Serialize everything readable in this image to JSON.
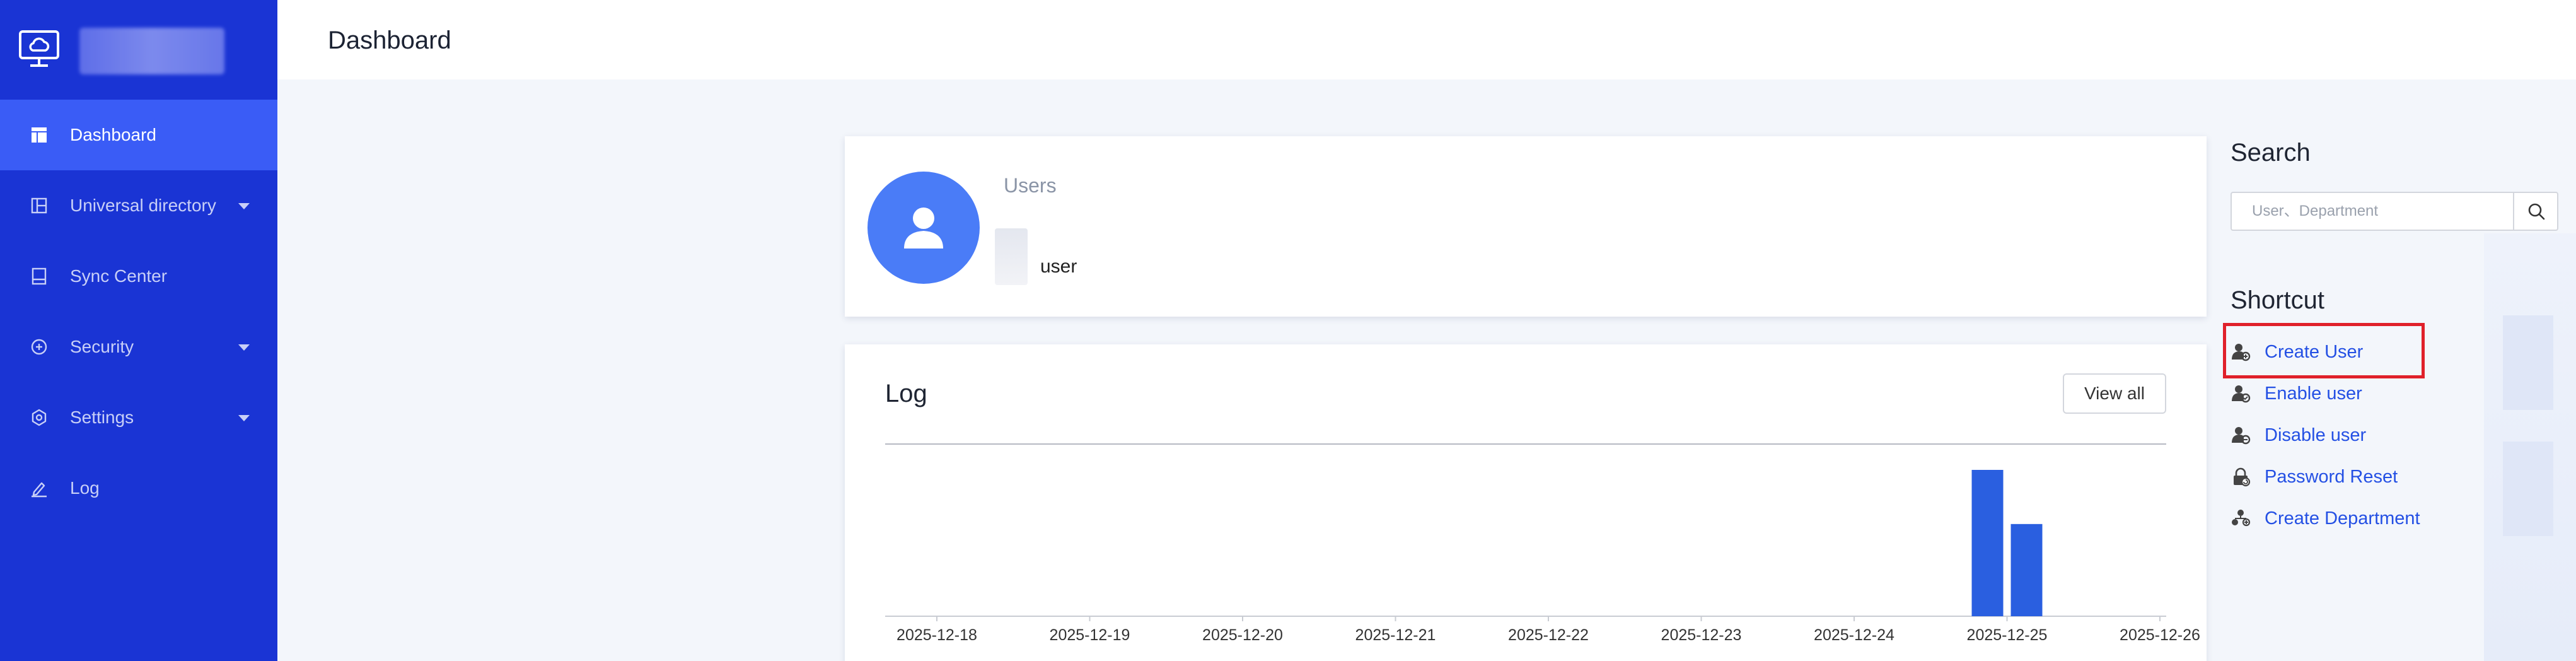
{
  "sidebar": {
    "items": [
      {
        "label": "Dashboard",
        "icon": "dashboard-icon",
        "active": true,
        "expandable": false
      },
      {
        "label": "Universal directory",
        "icon": "directory-icon",
        "active": false,
        "expandable": true
      },
      {
        "label": "Sync Center",
        "icon": "sync-icon",
        "active": false,
        "expandable": false
      },
      {
        "label": "Security",
        "icon": "shield-icon",
        "active": false,
        "expandable": true
      },
      {
        "label": "Settings",
        "icon": "gear-icon",
        "active": false,
        "expandable": true
      },
      {
        "label": "Log",
        "icon": "edit-icon",
        "active": false,
        "expandable": false
      }
    ]
  },
  "header": {
    "title": "Dashboard"
  },
  "users_card": {
    "title": "Users",
    "unit": "user"
  },
  "log_card": {
    "title": "Log",
    "view_all_label": "View all"
  },
  "chart_data": {
    "type": "bar",
    "title": "",
    "xlabel": "",
    "ylabel": "",
    "categories": [
      "2025-12-18",
      "2025-12-19",
      "2025-12-20",
      "2025-12-21",
      "2025-12-22",
      "2025-12-23",
      "2025-12-24",
      "2025-12-25",
      "2025-12-26"
    ],
    "series": [
      {
        "values": [
          0,
          0,
          0,
          0,
          0,
          0,
          0,
          100,
          0
        ]
      },
      {
        "values": [
          0,
          0,
          0,
          0,
          0,
          0,
          0,
          63,
          0
        ]
      }
    ],
    "ylim": [
      0,
      110
    ],
    "grid": false,
    "colors": [
      "#2a5fe0",
      "#2a5fe0"
    ]
  },
  "search": {
    "title": "Search",
    "placeholder": "User、Department"
  },
  "shortcuts": {
    "title": "Shortcut",
    "items": [
      {
        "label": "Create User",
        "icon": "user-add-icon"
      },
      {
        "label": "Enable user",
        "icon": "user-enable-icon"
      },
      {
        "label": "Disable user",
        "icon": "user-disable-icon"
      },
      {
        "label": "Password Reset",
        "icon": "lock-reset-icon"
      },
      {
        "label": "Create Department",
        "icon": "department-add-icon"
      }
    ]
  },
  "colors": {
    "sidebar_bg": "#1a34d4",
    "sidebar_active": "#3a5cf6",
    "accent": "#4a7cf7",
    "link": "#2450e4",
    "highlight": "#e0202a"
  }
}
